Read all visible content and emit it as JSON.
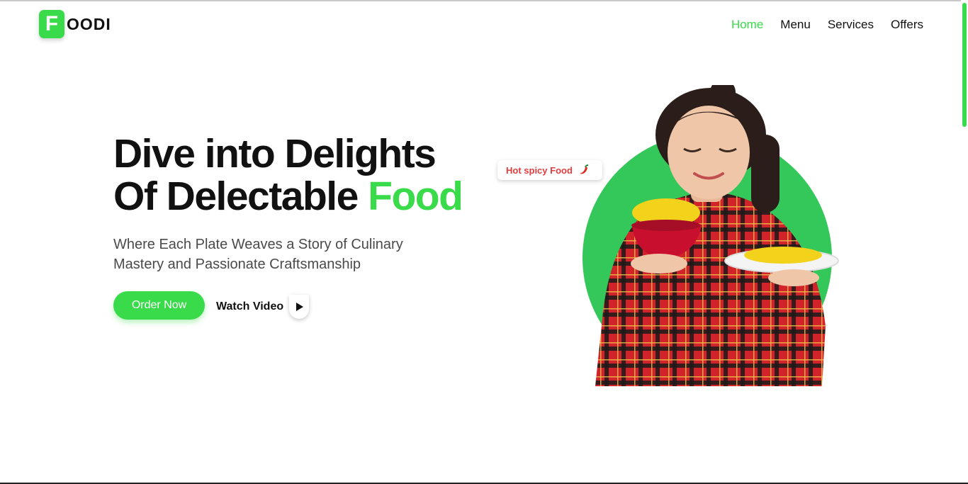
{
  "brand": {
    "logo_letter": "F",
    "logo_rest": "OODI",
    "accent_color": "#39db4a"
  },
  "nav": {
    "items": [
      {
        "label": "Home",
        "active": true
      },
      {
        "label": "Menu",
        "active": false
      },
      {
        "label": "Services",
        "active": false
      },
      {
        "label": "Offers",
        "active": false
      }
    ]
  },
  "hero": {
    "title_line1": "Dive into Delights",
    "title_line2_prefix": "Of Delectable ",
    "title_line2_accent": "Food",
    "subtitle": "Where Each Plate Weaves a Story of Culinary Mastery and Passionate Craftsmanship",
    "order_button": "Order Now",
    "watch_label": "Watch Video",
    "badge_text": "Hot spicy Food",
    "badge_icon": "chili-pepper-icon",
    "image": "woman-with-noodles"
  }
}
